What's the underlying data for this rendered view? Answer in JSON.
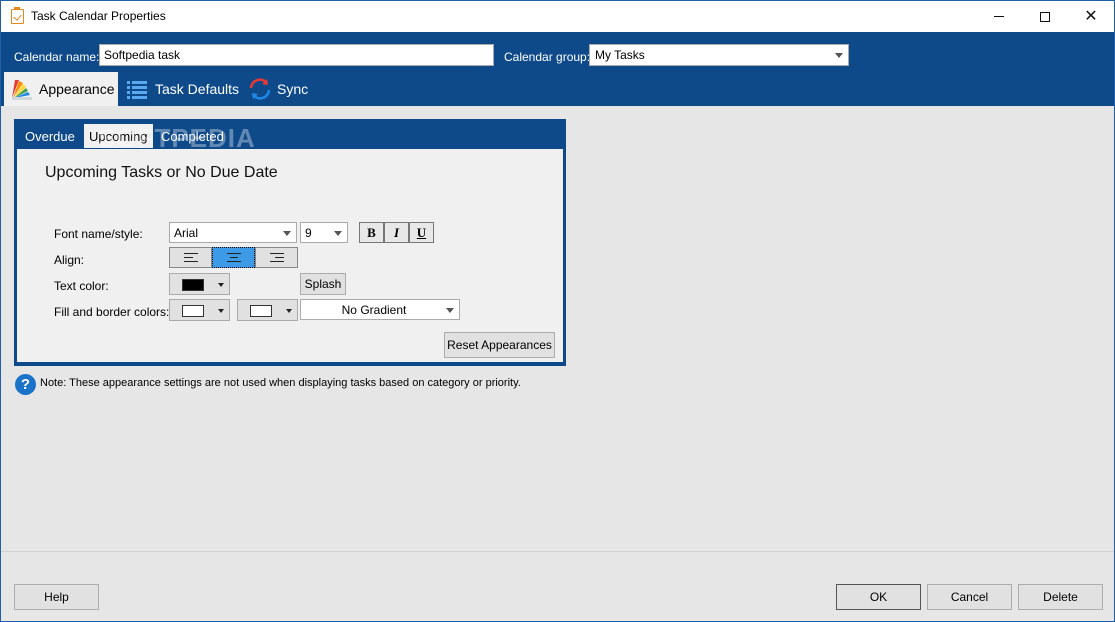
{
  "window": {
    "title": "Task Calendar Properties"
  },
  "header": {
    "calendar_name_label": "Calendar name:",
    "calendar_name_value": "Softpedia task",
    "calendar_group_label": "Calendar group:",
    "calendar_group_value": "My Tasks"
  },
  "main_tabs": [
    {
      "label": "Appearance",
      "active": true
    },
    {
      "label": "Task Defaults",
      "active": false
    },
    {
      "label": "Sync",
      "active": false
    }
  ],
  "sub_tabs": [
    {
      "label": "Overdue",
      "active": false
    },
    {
      "label": "Upcoming",
      "active": true
    },
    {
      "label": "Completed",
      "active": false
    }
  ],
  "section": {
    "title": "Upcoming Tasks or No Due Date",
    "font_label": "Font name/style:",
    "font_name": "Arial",
    "font_size": "9",
    "bold_label": "B",
    "italic_label": "I",
    "underline_label": "U",
    "align_label": "Align:",
    "align_selected": "center",
    "text_color_label": "Text color:",
    "text_color": "#000000",
    "splash_label": "Splash",
    "fill_border_label": "Fill and border colors:",
    "fill_color": "#ffffff",
    "border_color": "#ffffff",
    "gradient_value": "No Gradient",
    "reset_label": "Reset Appearances"
  },
  "note": {
    "icon": "question-icon",
    "text": "Note: These appearance settings are not used when displaying tasks based on category or priority."
  },
  "watermark": "SOFTPEDIA",
  "footer": {
    "help_label": "Help",
    "ok_label": "OK",
    "cancel_label": "Cancel",
    "delete_label": "Delete"
  },
  "colors": {
    "accent": "#0e4a8a",
    "selected_align": "#3c9ae6",
    "help_icon": "#1a73c8"
  }
}
